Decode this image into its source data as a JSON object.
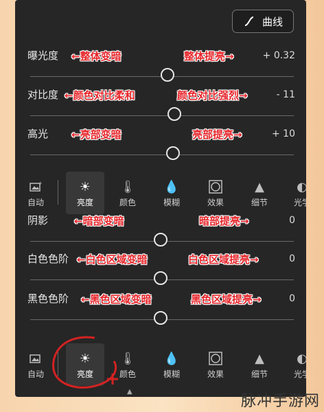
{
  "curve_button": {
    "label": "曲线"
  },
  "sliders_top": [
    {
      "label": "曝光度",
      "value": "+ 0.32",
      "left": "←整体变暗",
      "right": "整体提亮→",
      "pos": 0.5
    },
    {
      "label": "对比度",
      "value": "- 11",
      "left": "←颜色对比柔和",
      "right": "颜色对比强烈→",
      "pos": 0.48
    },
    {
      "label": "高光",
      "value": "+ 10",
      "left": "←亮部变暗",
      "right": "亮部提亮→",
      "pos": 0.51
    }
  ],
  "sliders_bottom": [
    {
      "label": "阴影",
      "value": "0",
      "left": "←暗部变暗",
      "right": "暗部提亮→",
      "pos": 0.47
    },
    {
      "label": "白色色阶",
      "value": "0",
      "left": "←白色区域变暗",
      "right": "白色区域提亮→",
      "pos": 0.47
    },
    {
      "label": "黑色色阶",
      "value": "0",
      "left": "←黑色区域变暗",
      "right": "黑色区域提亮→",
      "pos": 0.47
    }
  ],
  "toolbar": {
    "items": [
      {
        "label": "自动",
        "icon": "auto-image-icon"
      },
      {
        "label": "亮度",
        "icon": "sun-icon"
      },
      {
        "label": "颜色",
        "icon": "thermometer-icon"
      },
      {
        "label": "模糊",
        "icon": "drop-icon"
      },
      {
        "label": "效果",
        "icon": "vignette-icon"
      },
      {
        "label": "细节",
        "icon": "triangle-icon"
      },
      {
        "label": "光学",
        "icon": "lens-icon"
      }
    ]
  },
  "watermark": "脉冲手游网"
}
